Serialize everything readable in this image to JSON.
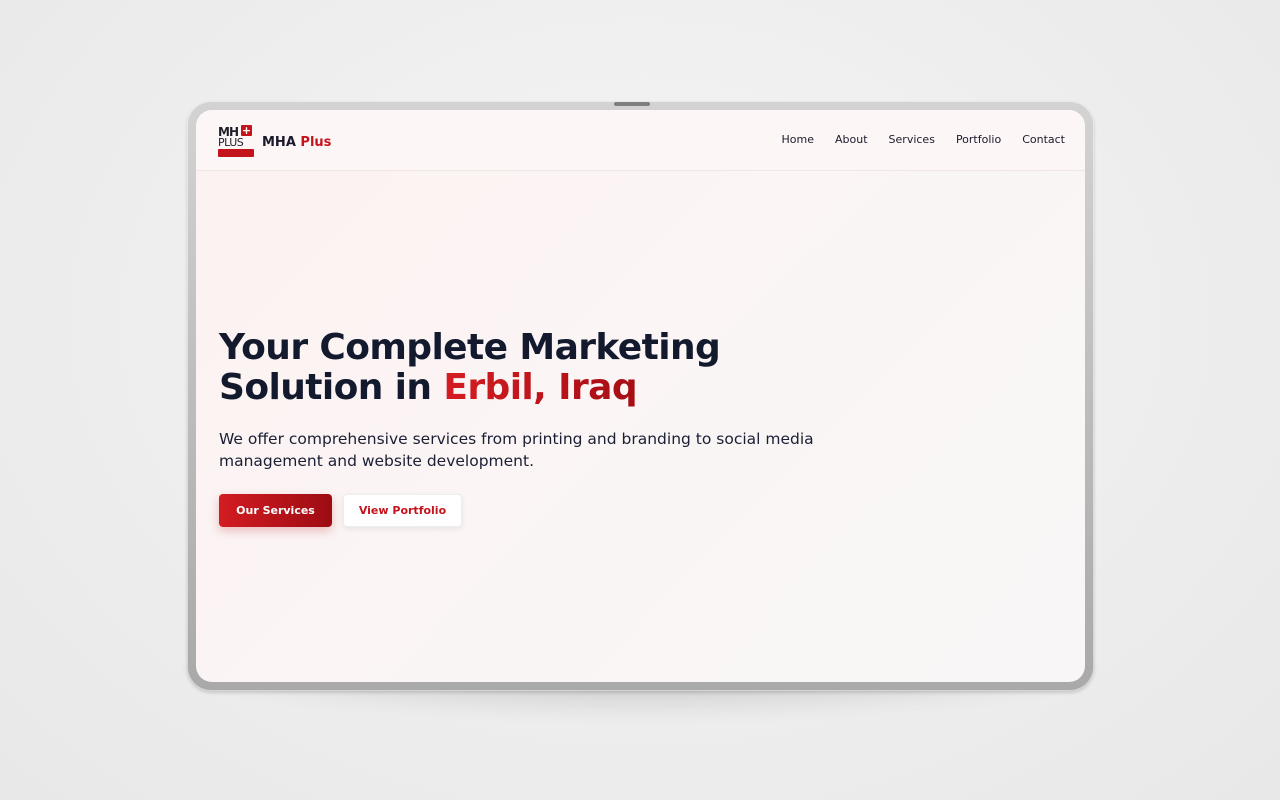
{
  "brand": {
    "logo_top": "MH",
    "logo_plus": "+",
    "logo_bottom": "PLUS",
    "name_main": "MHA",
    "name_accent": "Plus"
  },
  "nav": {
    "items": [
      {
        "label": "Home"
      },
      {
        "label": "About"
      },
      {
        "label": "Services"
      },
      {
        "label": "Portfolio"
      },
      {
        "label": "Contact"
      }
    ]
  },
  "hero": {
    "title_line1": "Your Complete Marketing",
    "title_line2_prefix": "Solution in ",
    "title_line2_accent": "Erbil, Iraq",
    "subtitle": "We offer comprehensive services from printing and branding to social media management and website development.",
    "primary_cta": "Our Services",
    "secondary_cta": "View Portfolio"
  },
  "colors": {
    "accent": "#c4141b",
    "accent_dark": "#9c0c12",
    "text_dark": "#131a2e"
  }
}
